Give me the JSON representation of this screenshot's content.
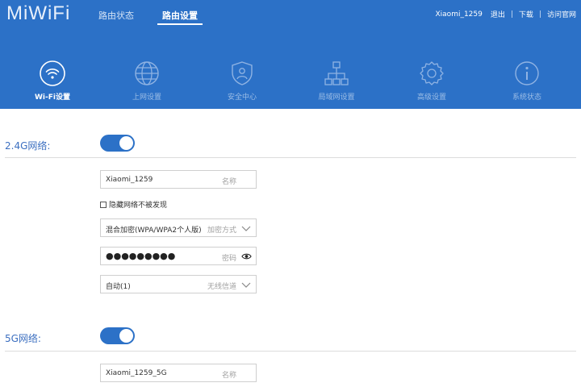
{
  "header": {
    "logo": "MiWiFi",
    "nav": [
      {
        "label": "路由状态"
      },
      {
        "label": "路由设置"
      }
    ],
    "user": "Xiaomi_1259",
    "links": [
      "退出",
      "下载",
      "访问官网"
    ]
  },
  "tabs": [
    {
      "label": "Wi-Fi设置",
      "icon": "wifi-icon"
    },
    {
      "label": "上网设置",
      "icon": "globe-icon"
    },
    {
      "label": "安全中心",
      "icon": "shield-icon"
    },
    {
      "label": "局域网设置",
      "icon": "lan-icon"
    },
    {
      "label": "高级设置",
      "icon": "gear-icon"
    },
    {
      "label": "系统状态",
      "icon": "info-icon"
    }
  ],
  "wifi24": {
    "section_label": "2.4G网络:",
    "ssid_value": "Xiaomi_1259",
    "ssid_hint": "名称",
    "hide_label": "隐藏网络不被发现",
    "encryption_value": "混合加密(WPA/WPA2个人版)",
    "encryption_hint": "加密方式",
    "password_mask": "●●●●●●●●●",
    "password_hint": "密码",
    "channel_value": "自动(1)",
    "channel_hint": "无线信道"
  },
  "wifi5": {
    "section_label": "5G网络:",
    "ssid_value": "Xiaomi_1259_5G",
    "ssid_hint": "名称"
  },
  "colors": {
    "brand_blue": "#2c71c7",
    "label_blue": "#3c6fc0"
  }
}
